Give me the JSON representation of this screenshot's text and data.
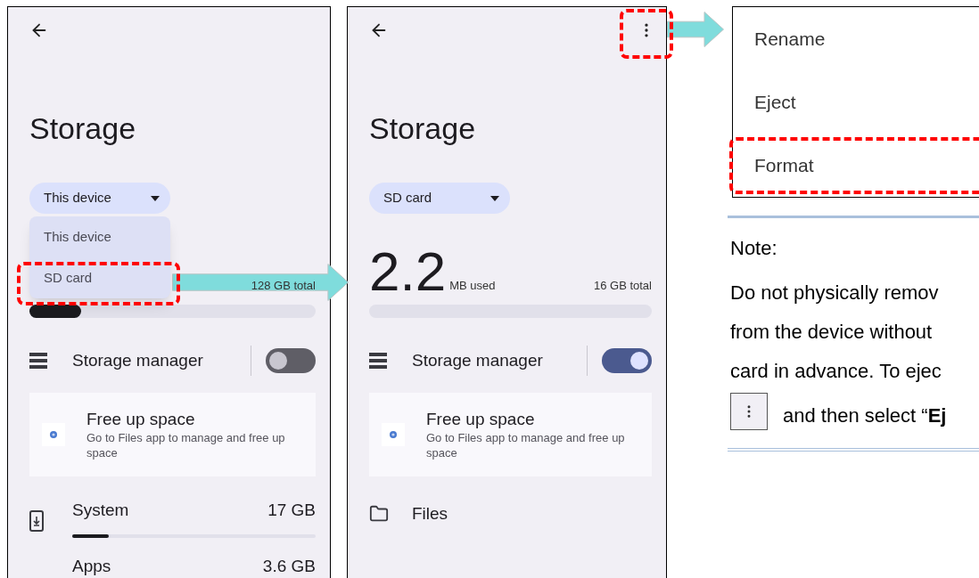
{
  "screens": [
    {
      "title": "Storage",
      "selector": "This device",
      "dropdown": [
        {
          "label": "This device",
          "highlighted": false
        },
        {
          "label": "SD card",
          "highlighted": true
        }
      ],
      "usage": {
        "total": "128 GB total",
        "level": 0.18
      },
      "storage_manager": {
        "label": "Storage manager",
        "on": false
      },
      "free_up": {
        "title": "Free up space",
        "subtitle": "Go to Files app to manage and free up space"
      },
      "rows": [
        {
          "kind": "category",
          "label": "System",
          "size": "17 GB",
          "level": 0.15
        },
        {
          "kind": "category",
          "label": "Apps",
          "size": "3.6 GB"
        }
      ]
    },
    {
      "title": "Storage",
      "selector": "SD card",
      "more_menu": {
        "highlighted": true
      },
      "usage": {
        "used": "2.2",
        "unit": "MB used",
        "total": "16 GB total",
        "level": 0
      },
      "storage_manager": {
        "label": "Storage manager",
        "on": true
      },
      "free_up": {
        "title": "Free up space",
        "subtitle": "Go to Files app to manage and free up space"
      },
      "rows": [
        {
          "kind": "folder",
          "label": "Files"
        }
      ]
    }
  ],
  "menu": {
    "items": [
      {
        "label": "Rename",
        "highlighted": false
      },
      {
        "label": "Eject",
        "highlighted": false
      },
      {
        "label": "Format",
        "highlighted": true
      }
    ]
  },
  "note": {
    "heading": "Note:",
    "text": "Do not physically remov\nfrom the device without\ncard in advance. To ejec",
    "last_line": "and then select “**Ej**"
  }
}
